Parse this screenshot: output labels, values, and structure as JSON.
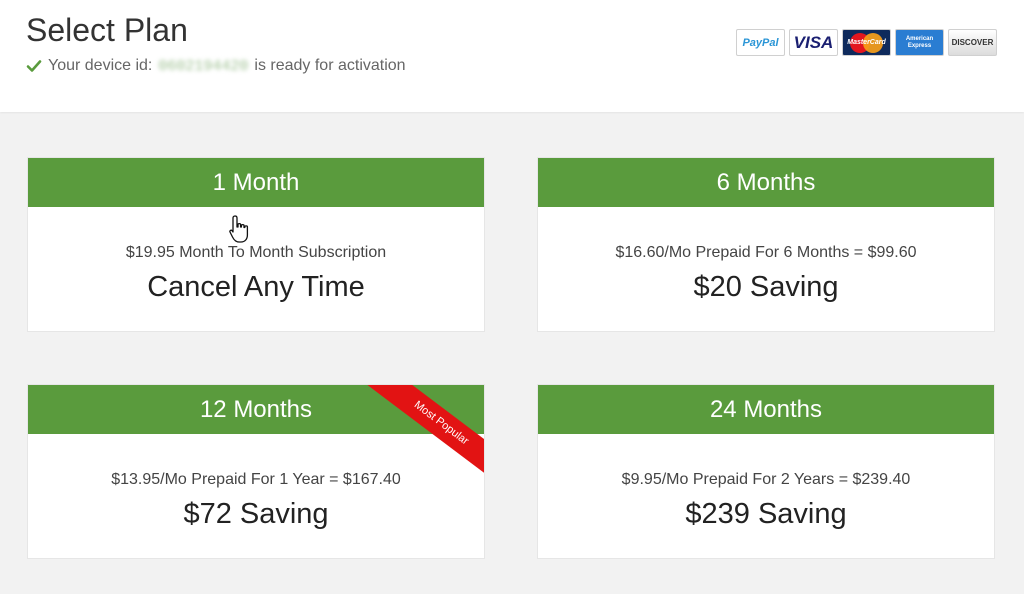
{
  "header": {
    "title": "Select Plan",
    "device_prefix": "Your device id:",
    "device_id": "0602194420",
    "device_suffix": "is ready for activation",
    "payment_methods": [
      "PayPal",
      "VISA",
      "MasterCard",
      "American Express",
      "DISCOVER"
    ]
  },
  "plans": [
    {
      "name": "1 Month",
      "description": "$19.95 Month To Month Subscription",
      "highlight": "Cancel Any Time"
    },
    {
      "name": "6 Months",
      "description": "$16.60/Mo Prepaid For 6 Months = $99.60",
      "highlight": "$20 Saving"
    },
    {
      "name": "12 Months",
      "description": "$13.95/Mo Prepaid For 1 Year = $167.40",
      "highlight": "$72 Saving",
      "badge": "Most Popular"
    },
    {
      "name": "24 Months",
      "description": "$9.95/Mo Prepaid For 2 Years = $239.40",
      "highlight": "$239 Saving"
    }
  ],
  "colors": {
    "plan_header": "#5a9b3d",
    "badge": "#e21313",
    "check": "#5a9b3d"
  }
}
